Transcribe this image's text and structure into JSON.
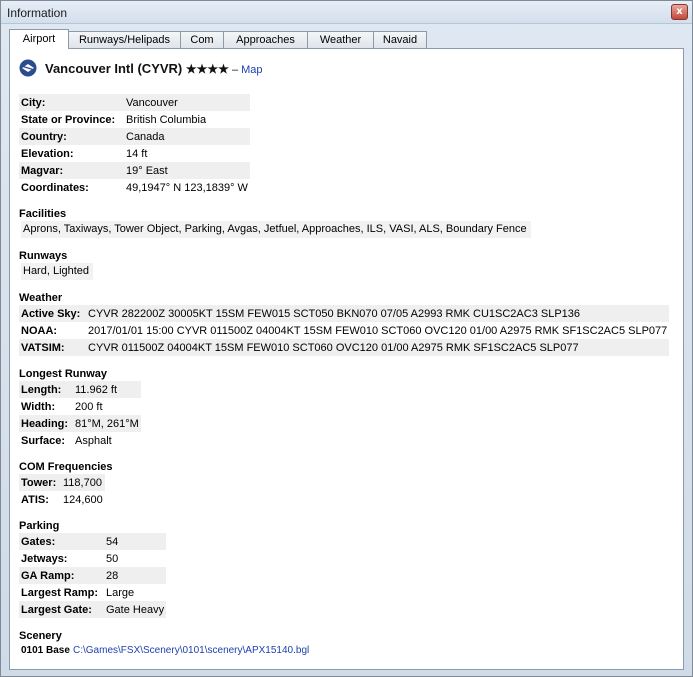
{
  "window": {
    "title": "Information",
    "close_glyph": "x",
    "close_icon": "close-icon"
  },
  "tabs": [
    {
      "label": "Airport",
      "active": true
    },
    {
      "label": "Runways/Helipads"
    },
    {
      "label": "Com"
    },
    {
      "label": "Approaches"
    },
    {
      "label": "Weather"
    },
    {
      "label": "Navaid"
    }
  ],
  "header": {
    "icon": "airport-logo-icon",
    "name": "Vancouver Intl (CYVR)",
    "stars": "★★★★",
    "dash": " – ",
    "map_link": "Map"
  },
  "general": [
    {
      "label": "City:",
      "value": "Vancouver"
    },
    {
      "label": "State or Province:",
      "value": "British Columbia"
    },
    {
      "label": "Country:",
      "value": "Canada"
    },
    {
      "label": "Elevation:",
      "value": "14 ft"
    },
    {
      "label": "Magvar:",
      "value": "19° East"
    },
    {
      "label": "Coordinates:",
      "value": "49,1947° N 123,1839° W"
    }
  ],
  "facilities": {
    "title": "Facilities",
    "text": "Aprons, Taxiways, Tower Object, Parking, Avgas, Jetfuel, Approaches, ILS, VASI, ALS, Boundary Fence"
  },
  "runways": {
    "title": "Runways",
    "text": "Hard, Lighted"
  },
  "weather": {
    "title": "Weather",
    "rows": [
      {
        "label": "Active Sky:",
        "value": "CYVR 282200Z 30005KT 15SM FEW015 SCT050 BKN070 07/05 A2993 RMK CU1SC2AC3 SLP136"
      },
      {
        "label": "NOAA:",
        "value": "2017/01/01 15:00 CYVR 011500Z 04004KT 15SM FEW010 SCT060 OVC120 01/00 A2975 RMK SF1SC2AC5 SLP077"
      },
      {
        "label": "VATSIM:",
        "value": "CYVR 011500Z 04004KT 15SM FEW010 SCT060 OVC120 01/00 A2975 RMK SF1SC2AC5 SLP077"
      }
    ]
  },
  "longest_runway": {
    "title": "Longest Runway",
    "rows": [
      {
        "label": "Length:",
        "value": "11.962 ft"
      },
      {
        "label": "Width:",
        "value": "200 ft"
      },
      {
        "label": "Heading:",
        "value": "81°M, 261°M"
      },
      {
        "label": "Surface:",
        "value": "Asphalt"
      }
    ]
  },
  "com": {
    "title": "COM Frequencies",
    "rows": [
      {
        "label": "Tower:",
        "value": "118,700"
      },
      {
        "label": "ATIS:",
        "value": "124,600"
      }
    ]
  },
  "parking": {
    "title": "Parking",
    "rows": [
      {
        "label": "Gates:",
        "value": "54"
      },
      {
        "label": "Jetways:",
        "value": "50"
      },
      {
        "label": "GA Ramp:",
        "value": "28"
      },
      {
        "label": "Largest Ramp:",
        "value": "Large"
      },
      {
        "label": "Largest Gate:",
        "value": "Gate Heavy"
      }
    ]
  },
  "scenery": {
    "title": "Scenery",
    "label": "0101 Base",
    "path": "C:\\Games\\FSX\\Scenery\\0101\\scenery\\APX15140.bgl"
  }
}
